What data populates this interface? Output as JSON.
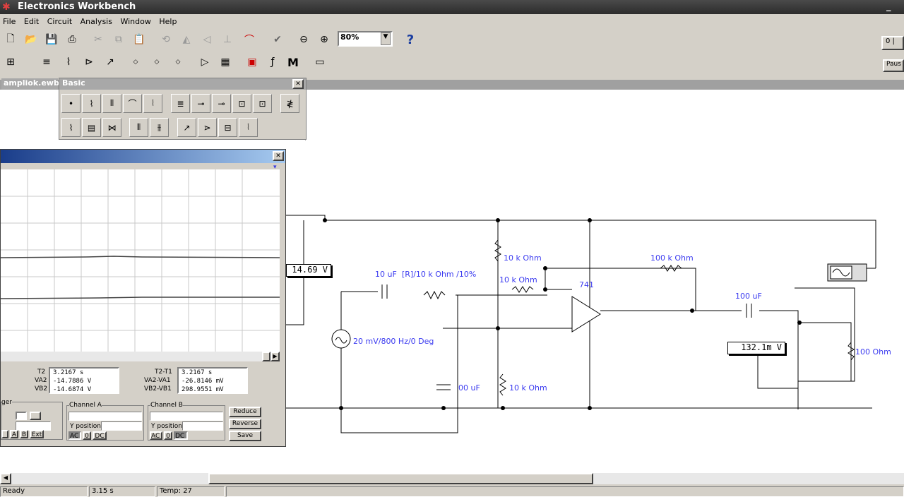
{
  "window": {
    "title": "Electronics Workbench",
    "min_label": "_"
  },
  "menu": [
    "File",
    "Edit",
    "Circuit",
    "Analysis",
    "Window",
    "Help"
  ],
  "toolbar": {
    "zoom_value": "80%",
    "help_label": "?",
    "pause_label": "Paus",
    "power_label": "0 |"
  },
  "doc": {
    "tab": "ampliok.ewb"
  },
  "basic_panel": {
    "title": "Basic",
    "close": "✕"
  },
  "scope": {
    "close": "✕",
    "readout": {
      "t2_label": "T2",
      "t2_value": "3.2167  s",
      "va2_label": "VA2",
      "va2_value": "-14.7886  V",
      "vb2_label": "VB2",
      "vb2_value": "-14.6874  V",
      "t2t1_label": "T2-T1",
      "t2t1_value": "3.2167  s",
      "va2va1_label": "VA2-VA1",
      "va2va1_value": "-26.8146  mV",
      "vb2vb1_label": "VB2-VB1",
      "vb2vb1_value": "298.9551  mV"
    },
    "trigger_label": "ger",
    "channel_a": "Channel A",
    "channel_b": "Channel B",
    "ypos_a": "Y position",
    "ypos_b": "Y position",
    "a_btns": [
      "AC",
      "0",
      "DC"
    ],
    "b_btns": [
      "AC",
      "0",
      "DC"
    ],
    "trig_btns": [
      "A",
      "B",
      "Ext"
    ],
    "reduce": "Reduce",
    "reverse": "Reverse",
    "save": "Save"
  },
  "circuit": {
    "meter_v": "14.69  V",
    "meter_mv": "132.1m V",
    "c1": "10 uF",
    "pot": "[R]/10 k Ohm /10%",
    "r_top": "10 k Ohm",
    "r_mid": "10 k Ohm",
    "r_bot": "10 k Ohm",
    "r_fb": "100 k Ohm",
    "opamp": "741",
    "c_out": "100 uF",
    "r_load": "100  Ohm",
    "c_bypass": "00 uF",
    "source": "20 mV/800 Hz/0 Deg"
  },
  "status": {
    "ready": "Ready",
    "time": "3.15 s",
    "temp": "Temp:  27"
  }
}
